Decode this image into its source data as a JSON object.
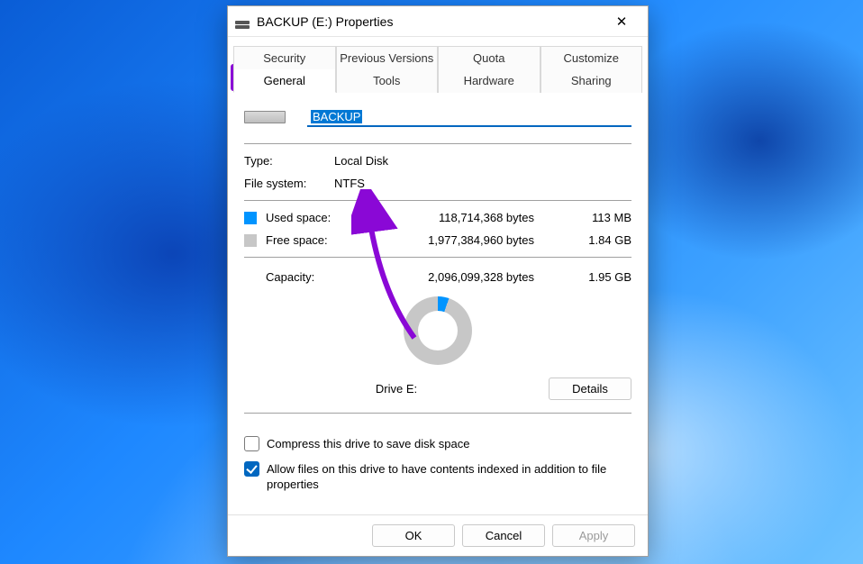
{
  "window": {
    "title": "BACKUP (E:) Properties"
  },
  "tabs": {
    "row1": [
      "Security",
      "Previous Versions",
      "Quota",
      "Customize"
    ],
    "row2": [
      "General",
      "Tools",
      "Hardware",
      "Sharing"
    ],
    "active": "General"
  },
  "drive": {
    "name": "BACKUP",
    "type_label": "Type:",
    "type_value": "Local Disk",
    "fs_label": "File system:",
    "fs_value": "NTFS",
    "used_label": "Used space:",
    "used_bytes": "118,714,368 bytes",
    "used_human": "113 MB",
    "free_label": "Free space:",
    "free_bytes": "1,977,384,960 bytes",
    "free_human": "1.84 GB",
    "capacity_label": "Capacity:",
    "capacity_bytes": "2,096,099,328 bytes",
    "capacity_human": "1.95 GB",
    "drive_label": "Drive E:",
    "details_button": "Details"
  },
  "options": {
    "compress_label": "Compress this drive to save disk space",
    "compress_checked": false,
    "index_label": "Allow files on this drive to have contents indexed in addition to file properties",
    "index_checked": true
  },
  "footer": {
    "ok": "OK",
    "cancel": "Cancel",
    "apply": "Apply"
  },
  "annotations": {
    "highlight_color": "#8a08d6",
    "arrow_color": "#8a08d6"
  }
}
